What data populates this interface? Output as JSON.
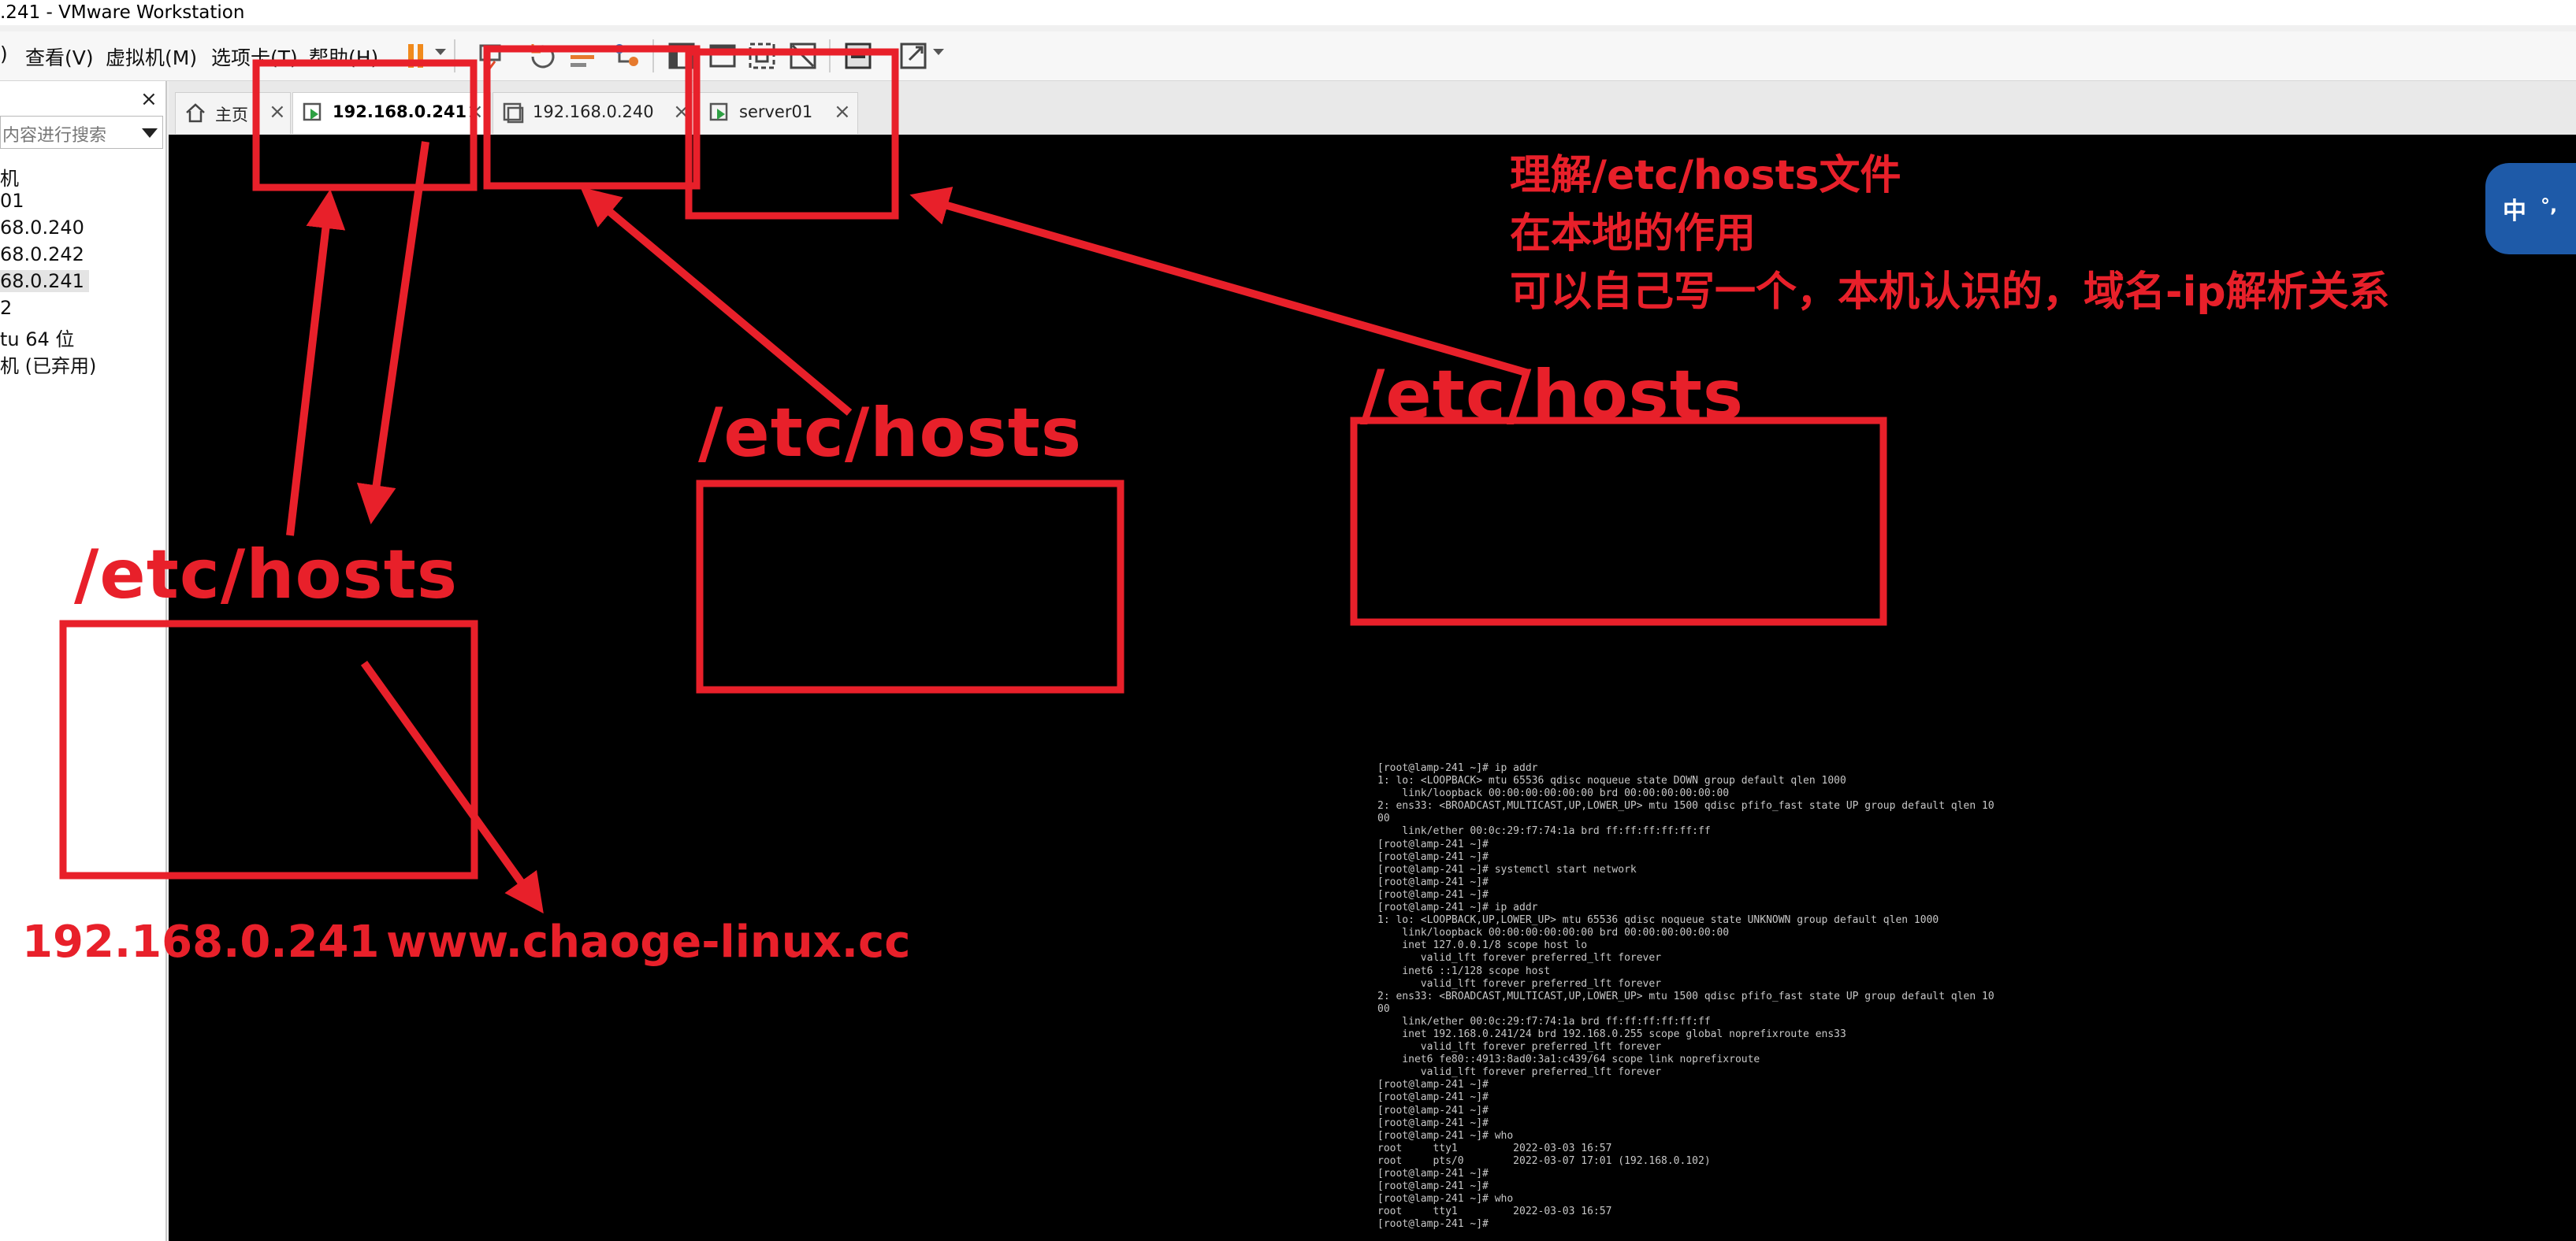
{
  "window": {
    "title": ".241 - VMware Workstation"
  },
  "menu": {
    "items": [
      {
        "label": ")"
      },
      {
        "label": "查看(V)"
      },
      {
        "label": "虚拟机(M)"
      },
      {
        "label": "选项卡(T)"
      },
      {
        "label": "帮助(H)"
      }
    ]
  },
  "toolbar": {
    "icons": [
      "pause-icon",
      "send-ctrl-alt-del-icon",
      "snapshot-icon",
      "revert-snapshot-icon",
      "manage-snapshots-icon",
      "show-library-icon",
      "console-view-icon",
      "thumbnail-view-icon",
      "unity-icon",
      "fullscreen-icon",
      "stretch-icon"
    ]
  },
  "sidebar": {
    "close": "×",
    "search_placeholder": "内容进行搜索",
    "items": [
      {
        "label": "机"
      },
      {
        "label": "01"
      },
      {
        "label": "68.0.240"
      },
      {
        "label": "68.0.242"
      },
      {
        "label": "68.0.241",
        "selected": true
      },
      {
        "label": "2"
      },
      {
        "label": "tu 64 位"
      },
      {
        "label": "机 (已弃用)"
      }
    ]
  },
  "tabs": [
    {
      "label": "主页",
      "icon": "home-icon",
      "close": "×"
    },
    {
      "label": "192.168.0.241",
      "icon": "vm-running-icon",
      "close": "×",
      "active": true
    },
    {
      "label": "192.168.0.240",
      "icon": "vm-icon",
      "close": "×"
    },
    {
      "label": "server01",
      "icon": "vm-running-icon",
      "close": "×"
    }
  ],
  "ime": {
    "label": "中",
    "extra": "°,"
  },
  "terminal": {
    "lines": [
      "[root@lamp-241 ~]# ip addr",
      "1: lo: <LOOPBACK> mtu 65536 qdisc noqueue state DOWN group default qlen 1000",
      "    link/loopback 00:00:00:00:00:00 brd 00:00:00:00:00:00",
      "2: ens33: <BROADCAST,MULTICAST,UP,LOWER_UP> mtu 1500 qdisc pfifo_fast state UP group default qlen 10",
      "00",
      "    link/ether 00:0c:29:f7:74:1a brd ff:ff:ff:ff:ff:ff",
      "[root@lamp-241 ~]#",
      "[root@lamp-241 ~]#",
      "[root@lamp-241 ~]# systemctl start network",
      "[root@lamp-241 ~]#",
      "[root@lamp-241 ~]#",
      "[root@lamp-241 ~]# ip addr",
      "1: lo: <LOOPBACK,UP,LOWER_UP> mtu 65536 qdisc noqueue state UNKNOWN group default qlen 1000",
      "    link/loopback 00:00:00:00:00:00 brd 00:00:00:00:00:00",
      "    inet 127.0.0.1/8 scope host lo",
      "       valid_lft forever preferred_lft forever",
      "    inet6 ::1/128 scope host",
      "       valid_lft forever preferred_lft forever",
      "2: ens33: <BROADCAST,MULTICAST,UP,LOWER_UP> mtu 1500 qdisc pfifo_fast state UP group default qlen 10",
      "00",
      "    link/ether 00:0c:29:f7:74:1a brd ff:ff:ff:ff:ff:ff",
      "    inet 192.168.0.241/24 brd 192.168.0.255 scope global noprefixroute ens33",
      "       valid_lft forever preferred_lft forever",
      "    inet6 fe80::4913:8ad0:3a1:c439/64 scope link noprefixroute",
      "       valid_lft forever preferred_lft forever",
      "[root@lamp-241 ~]#",
      "[root@lamp-241 ~]#",
      "[root@lamp-241 ~]#",
      "[root@lamp-241 ~]#",
      "[root@lamp-241 ~]# who",
      "root     tty1         2022-03-03 16:57",
      "root     pts/0        2022-03-07 17:01 (192.168.0.102)",
      "[root@lamp-241 ~]#",
      "[root@lamp-241 ~]#",
      "[root@lamp-241 ~]# who",
      "root     tty1         2022-03-03 16:57",
      "[root@lamp-241 ~]#"
    ]
  },
  "annotations": {
    "color": "#e8202a",
    "note_lines": [
      "理解/etc/hosts文件",
      "在本地的作用",
      "可以自己写一个，本机认识的，域名-ip解析关系"
    ],
    "hosts_label_left": "/etc/hosts",
    "hosts_label_middle": "/etc/hosts",
    "hosts_label_right": "/etc/hosts",
    "ip_label": "192.168.0.241",
    "domain_label": "www.chaoge-linux.cc"
  }
}
